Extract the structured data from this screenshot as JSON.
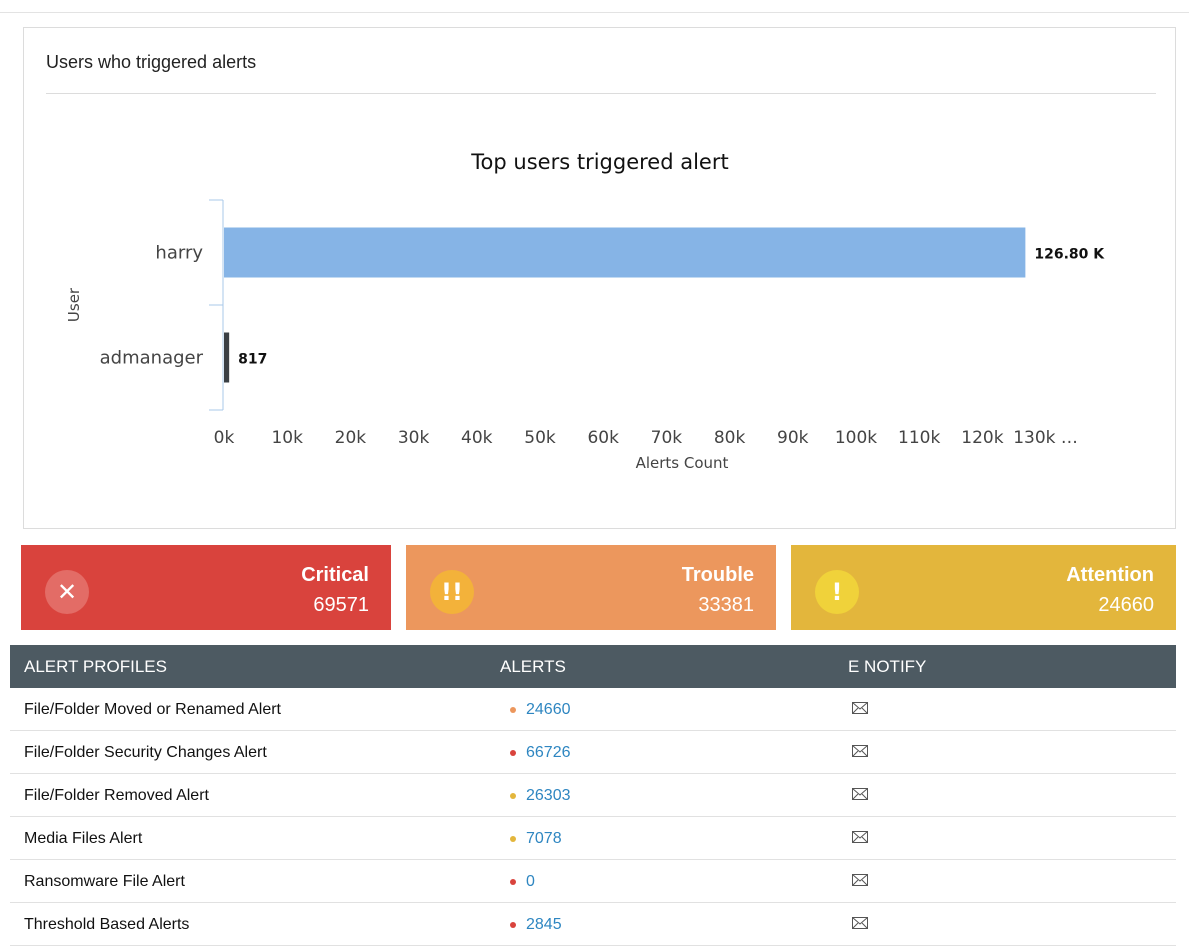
{
  "panel": {
    "title": "Users who triggered alerts"
  },
  "chart_data": {
    "type": "bar",
    "orientation": "horizontal",
    "title": "Top users triggered alert",
    "xlabel": "Alerts Count",
    "ylabel": "User",
    "categories": [
      "harry",
      "admanager"
    ],
    "values": [
      126800,
      817
    ],
    "data_labels": [
      "126.80 K",
      "817"
    ],
    "bar_colors": [
      "#86b4e6",
      "#3a3f44"
    ],
    "xlim": [
      0,
      130000
    ],
    "x_ticks": [
      "0k",
      "10k",
      "20k",
      "30k",
      "40k",
      "50k",
      "60k",
      "70k",
      "80k",
      "90k",
      "100k",
      "110k",
      "120k",
      "130k …"
    ]
  },
  "cards": [
    {
      "label": "Critical",
      "count": "69571",
      "icon": "x-icon",
      "glyph": "✕",
      "bg": "#d9433d",
      "circle": "#e36c66"
    },
    {
      "label": "Trouble",
      "count": "33381",
      "icon": "double-exclamation-icon",
      "glyph": "!!",
      "bg": "#ec975d",
      "circle": "#f3b23a"
    },
    {
      "label": "Attention",
      "count": "24660",
      "icon": "exclamation-icon",
      "glyph": "!",
      "bg": "#e3b63c",
      "circle": "#f0d23a"
    }
  ],
  "table": {
    "headers": [
      "ALERT PROFILES",
      "ALERTS",
      "E NOTIFY"
    ],
    "rows": [
      {
        "name": "File/Folder Moved or Renamed Alert",
        "count": "24660",
        "color": "#ec975d"
      },
      {
        "name": "File/Folder Security Changes Alert",
        "count": "66726",
        "color": "#d9433d"
      },
      {
        "name": "File/Folder Removed Alert",
        "count": "26303",
        "color": "#e3b63c"
      },
      {
        "name": "Media Files Alert",
        "count": "7078",
        "color": "#e3b63c"
      },
      {
        "name": "Ransomware File Alert",
        "count": "0",
        "color": "#d9433d"
      },
      {
        "name": "Threshold Based Alerts",
        "count": "2845",
        "color": "#d9433d"
      }
    ]
  }
}
